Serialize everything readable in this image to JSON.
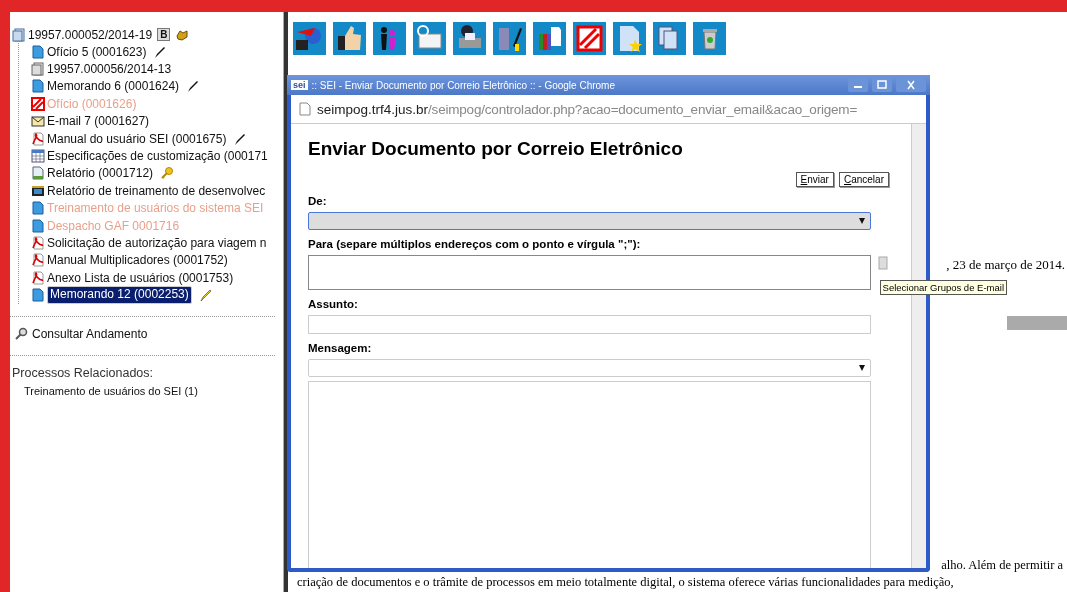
{
  "process_tree": {
    "root": {
      "label": "19957.000052/2014-19",
      "badge": "B"
    },
    "items": [
      {
        "kind": "document",
        "label": "Ofício 5 (0001623)",
        "dimmed": false,
        "selected": false,
        "signed": true,
        "editing": false,
        "key": false
      },
      {
        "kind": "process",
        "label": "19957.000056/2014-13",
        "dimmed": false,
        "selected": false,
        "signed": false,
        "editing": false,
        "key": false
      },
      {
        "kind": "document",
        "label": "Memorando 6 (0001624)",
        "dimmed": false,
        "selected": false,
        "signed": true,
        "editing": false,
        "key": false
      },
      {
        "kind": "canceled",
        "label": "Ofício (0001626)",
        "dimmed": true,
        "selected": false,
        "signed": false,
        "editing": false,
        "key": false
      },
      {
        "kind": "email",
        "label": "E-mail 7 (0001627)",
        "dimmed": false,
        "selected": false,
        "signed": false,
        "editing": false,
        "key": false
      },
      {
        "kind": "pdf",
        "label": "Manual do usuário SEI (0001675)",
        "dimmed": false,
        "selected": false,
        "signed": true,
        "editing": false,
        "key": false
      },
      {
        "kind": "spreadsheet",
        "label": "Especificações de customização (000171",
        "dimmed": false,
        "selected": false,
        "signed": false,
        "editing": false,
        "key": false
      },
      {
        "kind": "report",
        "label": "Relatório (0001712)",
        "dimmed": false,
        "selected": false,
        "signed": false,
        "editing": false,
        "key": true
      },
      {
        "kind": "video",
        "label": "Relatório de treinamento de desenvolvec",
        "dimmed": false,
        "selected": false,
        "signed": false,
        "editing": false,
        "key": false
      },
      {
        "kind": "document",
        "label": "Treinamento de usuários do sistema SEI",
        "dimmed": true,
        "selected": false,
        "signed": false,
        "editing": false,
        "key": false
      },
      {
        "kind": "document",
        "label": "Despacho GAF 0001716",
        "dimmed": true,
        "selected": false,
        "signed": false,
        "editing": false,
        "key": false
      },
      {
        "kind": "pdf",
        "label": "Solicitação de autorização para viagem n",
        "dimmed": false,
        "selected": false,
        "signed": false,
        "editing": false,
        "key": false
      },
      {
        "kind": "pdf",
        "label": "Manual Multiplicadores (0001752)",
        "dimmed": false,
        "selected": false,
        "signed": false,
        "editing": false,
        "key": false
      },
      {
        "kind": "pdf",
        "label": "Anexo Lista de usuários (0001753)",
        "dimmed": false,
        "selected": false,
        "signed": false,
        "editing": false,
        "key": false
      },
      {
        "kind": "document",
        "label": "Memorando 12 (0002253)",
        "dimmed": false,
        "selected": true,
        "signed": false,
        "editing": true,
        "key": false
      }
    ]
  },
  "consult_link": "Consultar Andamento",
  "related": {
    "heading": "Processos Relacionados:",
    "items": [
      "Treinamento de usuários do SEI (1)"
    ]
  },
  "document_text": {
    "date_line": ", 23 de março de 2014.",
    "line_end": "alho. Além de permitir a",
    "next_line": "criação de documentos e o trâmite de processos em meio totalmente digital, o sistema oferece várias funcionalidades para medição,"
  },
  "popup": {
    "logo": "sei",
    "title": ":: SEI - Enviar Documento por Correio Eletrônico :: - Google Chrome",
    "url_host": "seimpog.trf4.jus.br",
    "url_path": "/seimpog/controlador.php?acao=documento_enviar_email&acao_origem=",
    "heading": "Enviar Documento por Correio Eletrônico",
    "buttons": [
      "Enviar",
      "Cancelar"
    ],
    "fields": [
      {
        "kind": "select",
        "label": "De:",
        "focused": true
      },
      {
        "kind": "textarea",
        "label": "Para (separe múltiplos endereços com o ponto e vírgula \";\"):",
        "focused": false
      },
      {
        "kind": "input",
        "label": "Assunto:",
        "focused": false
      },
      {
        "kind": "select",
        "label": "Mensagem:",
        "focused": false
      },
      {
        "kind": "body",
        "focused": false
      }
    ],
    "tooltip": "Selecionar Grupos de E-mail"
  }
}
